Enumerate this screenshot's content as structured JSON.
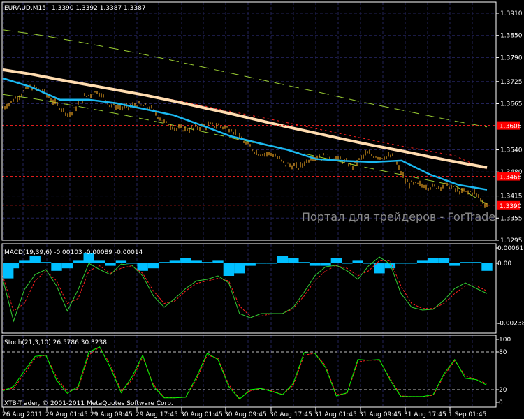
{
  "header": {
    "symbol": "EURAUD,M15",
    "ohlc": "1.3390 1.3392 1.3387 1.3387"
  },
  "watermark": "Портал для трейдеров - ForTrader.ru",
  "copyright": "XTB-Trader, © 2001-2011 MetaQuotes Software Corp.",
  "colors": {
    "background": "#000000",
    "grid": "#23235a",
    "bars": "#e8a020",
    "slow_ma": "#ffdcb0",
    "fast_ma": "#1ab8f0",
    "envelope": "#9acd32",
    "red_line": "#ff2020",
    "macd_hist": "#00bfff",
    "macd_main": "#32cd32",
    "stoch_main": "#00ff00"
  },
  "chart_data": [
    {
      "type": "line",
      "title": "EURAUD,M15",
      "ylim": [
        1.3295,
        1.391
      ],
      "y_ticks": [
        "1.3910",
        "1.3850",
        "1.3790",
        "1.3725",
        "1.3665",
        "1.3540",
        "1.3480",
        "1.3415",
        "1.3355",
        "1.3295"
      ],
      "price_tags": [
        {
          "label": "1.3606",
          "value": 1.3606
        },
        {
          "label": "1.3468",
          "value": 1.3468
        },
        {
          "label": "1.3390",
          "value": 1.339
        }
      ],
      "close": [
        1.3653,
        1.3681,
        1.371,
        1.37,
        1.3662,
        1.3634,
        1.3681,
        1.37,
        1.3662,
        1.3653,
        1.3662,
        1.3653,
        1.3615,
        1.3596,
        1.3596,
        1.3606,
        1.3606,
        1.3596,
        1.3558,
        1.353,
        1.353,
        1.3502,
        1.3492,
        1.3521,
        1.3521,
        1.3515,
        1.3496,
        1.353,
        1.3521,
        1.3521,
        1.3451,
        1.3445,
        1.3439,
        1.3445,
        1.3426,
        1.3426,
        1.339
      ],
      "slow_ma": [
        1.3757,
        1.3745,
        1.373,
        1.3716,
        1.3702,
        1.3688,
        1.3672,
        1.3655,
        1.3638,
        1.362,
        1.3602,
        1.3585,
        1.3568,
        1.3552,
        1.3537,
        1.3521,
        1.3506,
        1.3492
      ],
      "fast_ma": [
        1.3734,
        1.371,
        1.3676,
        1.3676,
        1.3666,
        1.365,
        1.3634,
        1.3606,
        1.3577,
        1.3558,
        1.354,
        1.3515,
        1.351,
        1.3507,
        1.3511,
        1.3473,
        1.3445,
        1.3432
      ],
      "upper_envelope": [
        1.3865,
        1.3853,
        1.3838,
        1.3822,
        1.3805,
        1.3787,
        1.3768,
        1.3749,
        1.373,
        1.3711,
        1.3692,
        1.3672,
        1.3654,
        1.3636,
        1.3618,
        1.3602
      ],
      "lower_envelope": [
        1.369,
        1.3678,
        1.3663,
        1.3647,
        1.363,
        1.3612,
        1.3593,
        1.3574,
        1.3555,
        1.3536,
        1.3517,
        1.3497,
        1.3479,
        1.3461,
        1.3443,
        1.3393
      ],
      "mid_envelope": [
        1.3755,
        1.3742,
        1.3728,
        1.3712,
        1.3697,
        1.368,
        1.3663,
        1.3645,
        1.3628,
        1.361,
        1.3592,
        1.3574,
        1.3556,
        1.354,
        1.3524,
        1.3485
      ]
    },
    {
      "type": "bar",
      "title": "MACD(19,39,6) -0.00103 -0.00089 -0.00014",
      "ylim": [
        -0.00238,
        0.00061
      ],
      "y_ticks": [
        "0.00061",
        "0.00",
        "-0.00238"
      ],
      "histogram": [
        -0.0006,
        -0.0002,
        0.0001,
        0.0003,
        5e-05,
        -0.0003,
        -0.0002,
        0.0001,
        0.0004,
        0.0001,
        -0.0001,
        0.0001,
        0,
        -0.0003,
        -0.0002,
        5e-05,
        0.0001,
        0.0002,
        0.0001,
        5e-05,
        0.0001,
        -0.0005,
        -0.0004,
        -0.0001,
        0,
        0,
        0.0003,
        0.0002,
        5e-05,
        -0.0001,
        -0.0001,
        0.0002,
        0,
        0.0001,
        0,
        -0.0004,
        -0.0002,
        0,
        0,
        0.0001,
        0.0002,
        0.0002,
        -0.0001,
        5e-05,
        5e-05,
        -0.0003
      ],
      "main": [
        -0.00064,
        -0.0023,
        -0.00105,
        -0.00045,
        -0.00025,
        -0.0009,
        -0.0019,
        -0.00105,
        0,
        -0.00025,
        -0.00045,
        -3e-05,
        -8e-05,
        -0.0005,
        -0.0013,
        -0.00175,
        -0.0014,
        -0.001,
        -0.0007,
        -0.00064,
        -0.0005,
        -0.00078,
        -0.002,
        -0.00217,
        -0.002,
        -0.002,
        -0.002,
        -0.00175,
        -0.00115,
        -0.0005,
        -0.00014,
        -8e-05,
        -0.0003,
        -0.00064,
        -0.0001,
        0.00025,
        -3e-05,
        -0.0012,
        -0.00175,
        -0.00186,
        -0.00183,
        -0.00147,
        -0.001,
        -0.00078,
        -0.001,
        -0.0012
      ],
      "signal": [
        -0.0005,
        -0.0019,
        -0.0016,
        -0.0007,
        -0.0003,
        -0.0007,
        -0.0016,
        -0.0014,
        -0.0003,
        -0.0001,
        -0.0004,
        -0.0002,
        -0.0001,
        -0.0004,
        -0.0011,
        -0.0016,
        -0.0015,
        -0.0011,
        -0.0008,
        -0.0007,
        -0.0006,
        -0.0007,
        -0.0017,
        -0.0021,
        -0.0021,
        -0.002,
        -0.002,
        -0.0018,
        -0.0013,
        -0.0007,
        -0.0003,
        -0.0001,
        -0.0002,
        -0.0005,
        -0.0003,
        0.0001,
        0.0001,
        -0.0009,
        -0.0016,
        -0.0018,
        -0.0018,
        -0.0016,
        -0.0012,
        -0.0009,
        -0.0009,
        -0.0011
      ]
    },
    {
      "type": "line",
      "title": "Stoch(21,3,10) 26.5786 30.3238",
      "ylim": [
        0,
        100
      ],
      "y_ticks": [
        "100",
        "80",
        "20",
        "0"
      ],
      "levels": [
        80,
        20
      ],
      "main": [
        18,
        25,
        50,
        73,
        75,
        35,
        14,
        25,
        80,
        88,
        55,
        15,
        40,
        75,
        25,
        7,
        7,
        8,
        40,
        78,
        68,
        25,
        5,
        20,
        22,
        17,
        12,
        30,
        79,
        78,
        55,
        10,
        15,
        68,
        67,
        68,
        35,
        9,
        9,
        9,
        12,
        45,
        68,
        38,
        36,
        27
      ],
      "signal": [
        20,
        22,
        45,
        70,
        75,
        40,
        16,
        22,
        75,
        88,
        60,
        18,
        35,
        72,
        28,
        8,
        7,
        8,
        36,
        75,
        70,
        28,
        6,
        18,
        22,
        18,
        12,
        27,
        75,
        78,
        58,
        12,
        14,
        64,
        67,
        67,
        38,
        10,
        9,
        9,
        11,
        42,
        66,
        42,
        36,
        30
      ]
    }
  ],
  "x_ticks": [
    "26 Aug 2011",
    "29 Aug 01:45",
    "29 Aug 09:45",
    "29 Aug 17:45",
    "30 Aug 01:45",
    "30 Aug 09:45",
    "30 Aug 17:45",
    "31 Aug 01:45",
    "31 Aug 09:45",
    "31 Aug 17:45",
    "1 Sep 01:45"
  ]
}
